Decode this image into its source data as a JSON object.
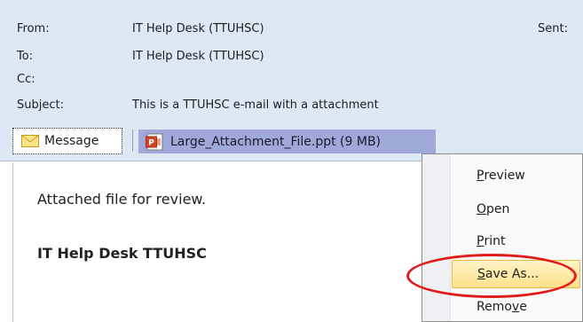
{
  "header": {
    "from_label": "From:",
    "from_value": "IT Help Desk (TTUHSC)",
    "to_label": "To:",
    "to_value": "IT Help Desk (TTUHSC)",
    "cc_label": "Cc:",
    "cc_value": "",
    "subject_label": "Subject:",
    "subject_value": "This is a TTUHSC e-mail with a attachment",
    "sent_label": "Sent:"
  },
  "tabs": {
    "message_label": "Message",
    "attachment_label": "Large_Attachment_File.ppt (9 MB)"
  },
  "body": {
    "line1": "Attached file for review.",
    "line2": "IT Help Desk TTUHSC"
  },
  "context_menu": {
    "items": [
      {
        "mnemonic": "P",
        "rest": "review"
      },
      {
        "mnemonic": "O",
        "rest": "pen"
      },
      {
        "mnemonic": "P",
        "rest": "rint"
      },
      {
        "mnemonic": "S",
        "rest": "ave As..."
      },
      {
        "pre": "Remo",
        "mnemonic": "v",
        "rest": "e"
      }
    ]
  },
  "colors": {
    "header_bg": "#dde8f5",
    "attachment_tab_bg": "#9fa9d9",
    "menu_highlight": "#fde08a",
    "annotation_red": "#e11a1a"
  },
  "icons": {
    "message_tab": "envelope-icon",
    "attachment_tab": "powerpoint-file-icon"
  }
}
